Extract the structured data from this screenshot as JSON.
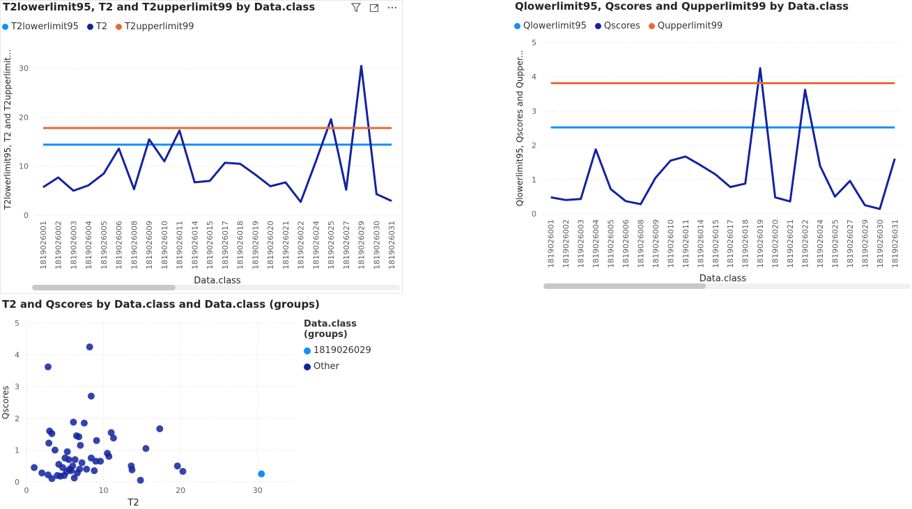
{
  "colors": {
    "lower": "#118DFF",
    "main": "#12239E",
    "upper": "#E66C37",
    "grid": "#d0d0d0",
    "text": "#605E5C"
  },
  "icons": [
    "filter-icon",
    "focus-mode-icon",
    "more-options-icon"
  ],
  "categories": [
    "1819026001",
    "1819026002",
    "1819026003",
    "1819026004",
    "1819026005",
    "1819026006",
    "1819026008",
    "1819026009",
    "1819026010",
    "1819026011",
    "1819026014",
    "1819026015",
    "1819026017",
    "1819026018",
    "1819026019",
    "1819026020",
    "1819026021",
    "1819026022",
    "1819026024",
    "1819026025",
    "1819026027",
    "1819026029",
    "1819026030",
    "1819026031"
  ],
  "chart_data": [
    {
      "type": "line",
      "title": "T2lowerlimit95, T2 and T2upperlimit99 by Data.class",
      "xlabel": "Data.class",
      "ylabel": "T2lowerlimit95, T2 and T2upperlimit...",
      "yticks": [
        "0",
        "10",
        "20",
        "30"
      ],
      "ylim": [
        0,
        35
      ],
      "grid": true,
      "legend_position": "top-left",
      "series": [
        {
          "name": "T2lowerlimit95",
          "values": [
            14.4,
            14.4,
            14.4,
            14.4,
            14.4,
            14.4,
            14.4,
            14.4,
            14.4,
            14.4,
            14.4,
            14.4,
            14.4,
            14.4,
            14.4,
            14.4,
            14.4,
            14.4,
            14.4,
            14.4,
            14.4,
            14.4,
            14.4,
            14.4
          ]
        },
        {
          "name": "T2",
          "values": [
            5.7,
            7.7,
            5.0,
            6.1,
            8.5,
            13.6,
            5.3,
            15.5,
            11.0,
            17.3,
            6.7,
            7.0,
            10.7,
            10.5,
            8.3,
            5.9,
            6.7,
            2.7,
            11.0,
            19.6,
            5.2,
            30.5,
            4.3,
            2.9
          ]
        },
        {
          "name": "T2upperlimit99",
          "values": [
            17.8,
            17.8,
            17.8,
            17.8,
            17.8,
            17.8,
            17.8,
            17.8,
            17.8,
            17.8,
            17.8,
            17.8,
            17.8,
            17.8,
            17.8,
            17.8,
            17.8,
            17.8,
            17.8,
            17.8,
            17.8,
            17.8,
            17.8,
            17.8
          ]
        }
      ]
    },
    {
      "type": "line",
      "title": "Qlowerlimit95, Qscores and Qupperlimit99 by Data.class",
      "xlabel": "Data.class",
      "ylabel": "Qlowerlimit95, Qscores and Qupper...",
      "yticks": [
        "0",
        "1",
        "2",
        "3",
        "4",
        "5"
      ],
      "ylim": [
        0,
        5
      ],
      "grid": true,
      "legend_position": "top-left",
      "series": [
        {
          "name": "Qlowerlimit95",
          "values": [
            2.52,
            2.52,
            2.52,
            2.52,
            2.52,
            2.52,
            2.52,
            2.52,
            2.52,
            2.52,
            2.52,
            2.52,
            2.52,
            2.52,
            2.52,
            2.52,
            2.52,
            2.52,
            2.52,
            2.52,
            2.52,
            2.52,
            2.52,
            2.52
          ]
        },
        {
          "name": "Qscores",
          "values": [
            0.48,
            0.4,
            0.43,
            1.88,
            0.72,
            0.37,
            0.28,
            1.05,
            1.55,
            1.67,
            1.42,
            1.15,
            0.78,
            0.88,
            4.25,
            0.48,
            0.36,
            3.62,
            1.4,
            0.5,
            0.96,
            0.25,
            0.14,
            1.61
          ]
        },
        {
          "name": "Qupperlimit99",
          "values": [
            3.81,
            3.81,
            3.81,
            3.81,
            3.81,
            3.81,
            3.81,
            3.81,
            3.81,
            3.81,
            3.81,
            3.81,
            3.81,
            3.81,
            3.81,
            3.81,
            3.81,
            3.81,
            3.81,
            3.81,
            3.81,
            3.81,
            3.81,
            3.81
          ]
        }
      ]
    },
    {
      "type": "scatter",
      "title": "T2 and Qscores by Data.class and Data.class (groups)",
      "xlabel": "T2",
      "ylabel": "Qscores",
      "xticks": [
        "0",
        "10",
        "20",
        "30"
      ],
      "yticks": [
        "0",
        "1",
        "2",
        "3",
        "4",
        "5"
      ],
      "xlim": [
        0,
        35
      ],
      "ylim": [
        0,
        5
      ],
      "grid": true,
      "legend_title": "Data.class (groups)",
      "legend_position": "right",
      "series": [
        {
          "name": "1819026029",
          "points": [
            [
              30.5,
              0.25
            ]
          ]
        },
        {
          "name": "Other",
          "points": [
            [
              1,
              0.45
            ],
            [
              2,
              0.28
            ],
            [
              2.8,
              3.62
            ],
            [
              2.8,
              0.22
            ],
            [
              2.9,
              1.22
            ],
            [
              3,
              1.6
            ],
            [
              3.3,
              1.52
            ],
            [
              3.3,
              0.1
            ],
            [
              3.7,
              1.0
            ],
            [
              4,
              0.2
            ],
            [
              4.2,
              0.55
            ],
            [
              4.4,
              0.18
            ],
            [
              4.7,
              0.45
            ],
            [
              4.9,
              0.2
            ],
            [
              5,
              0.75
            ],
            [
              5.2,
              0.32
            ],
            [
              5.3,
              0.95
            ],
            [
              5.5,
              0.7
            ],
            [
              5.6,
              0.4
            ],
            [
              5.8,
              0.35
            ],
            [
              6,
              0.5
            ],
            [
              6.1,
              1.88
            ],
            [
              6.2,
              0.12
            ],
            [
              6.3,
              0.7
            ],
            [
              6.5,
              1.45
            ],
            [
              6.6,
              0.28
            ],
            [
              6.8,
              1.42
            ],
            [
              6.9,
              0.4
            ],
            [
              7,
              1.15
            ],
            [
              7.2,
              0.6
            ],
            [
              7.5,
              1.85
            ],
            [
              7.8,
              0.4
            ],
            [
              8.2,
              4.25
            ],
            [
              8.4,
              2.7
            ],
            [
              8.4,
              0.75
            ],
            [
              8.8,
              0.35
            ],
            [
              9,
              0.65
            ],
            [
              9.1,
              1.3
            ],
            [
              9.6,
              0.65
            ],
            [
              10.5,
              0.9
            ],
            [
              10.7,
              0.8
            ],
            [
              11,
              1.55
            ],
            [
              11.3,
              1.38
            ],
            [
              13.6,
              0.5
            ],
            [
              13.7,
              0.38
            ],
            [
              14.8,
              0.05
            ],
            [
              15.5,
              1.05
            ],
            [
              17.3,
              1.67
            ],
            [
              19.6,
              0.5
            ],
            [
              20.3,
              0.33
            ]
          ]
        }
      ]
    }
  ]
}
